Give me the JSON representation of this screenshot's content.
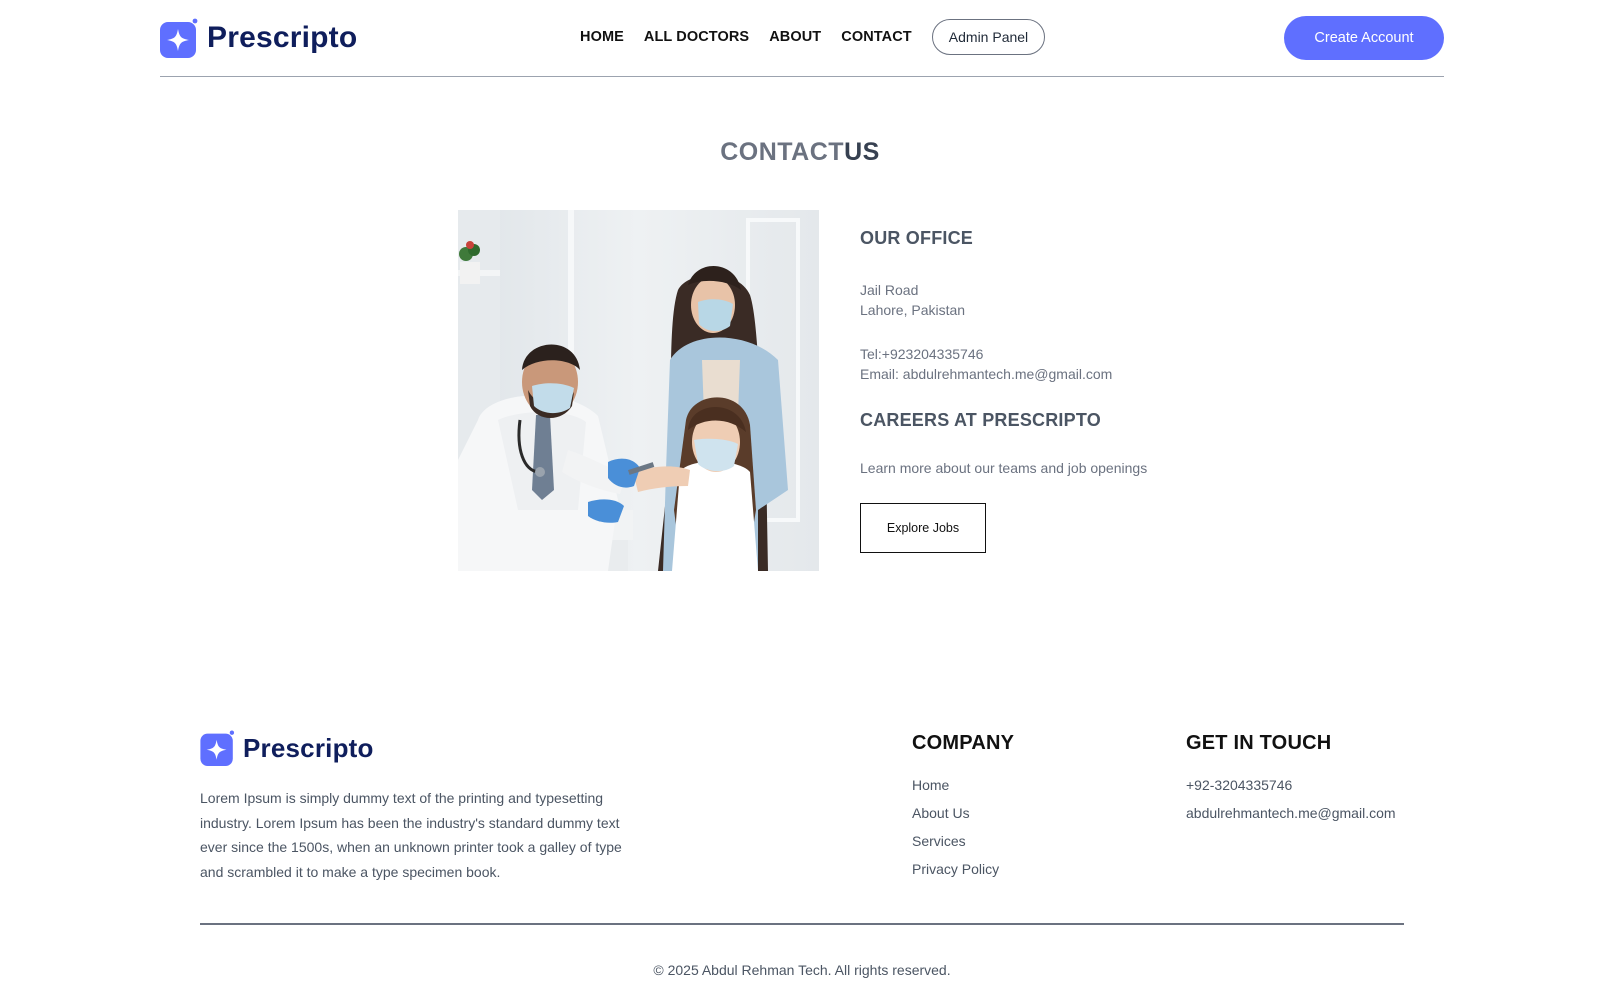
{
  "brand": {
    "name": "Prescripto",
    "accent": "#5f6fff",
    "dark": "#0f1e5c"
  },
  "nav": {
    "links": [
      {
        "label": "HOME"
      },
      {
        "label": "ALL DOCTORS"
      },
      {
        "label": "ABOUT"
      },
      {
        "label": "CONTACT"
      }
    ],
    "admin_label": "Admin Panel",
    "create_account_label": "Create Account"
  },
  "main": {
    "title_light": "CONTACT",
    "title_bold": "US",
    "image_alt": "Doctor vaccinating a girl while her mother watches",
    "office": {
      "heading": "OUR OFFICE",
      "address_line1": "Jail Road",
      "address_line2": "Lahore, Pakistan",
      "tel": "Tel:+923204335746",
      "email": "Email: abdulrehmantech.me@gmail.com"
    },
    "careers": {
      "heading": "CAREERS AT PRESCRIPTO",
      "text": "Learn more about our teams and job openings",
      "button_label": "Explore Jobs"
    }
  },
  "footer": {
    "brand": "Prescripto",
    "description": "Lorem Ipsum is simply dummy text of the printing and typesetting industry. Lorem Ipsum has been the industry's standard dummy text ever since the 1500s, when an unknown printer took a galley of type and scrambled it to make a type specimen book.",
    "company": {
      "heading": "COMPANY",
      "items": [
        "Home",
        "About Us",
        "Services",
        "Privacy Policy"
      ]
    },
    "contact": {
      "heading": "GET IN TOUCH",
      "items": [
        "+92-3204335746",
        "abdulrehmantech.me@gmail.com"
      ]
    },
    "copyright": "© 2025 Abdul Rehman Tech. All rights reserved."
  }
}
